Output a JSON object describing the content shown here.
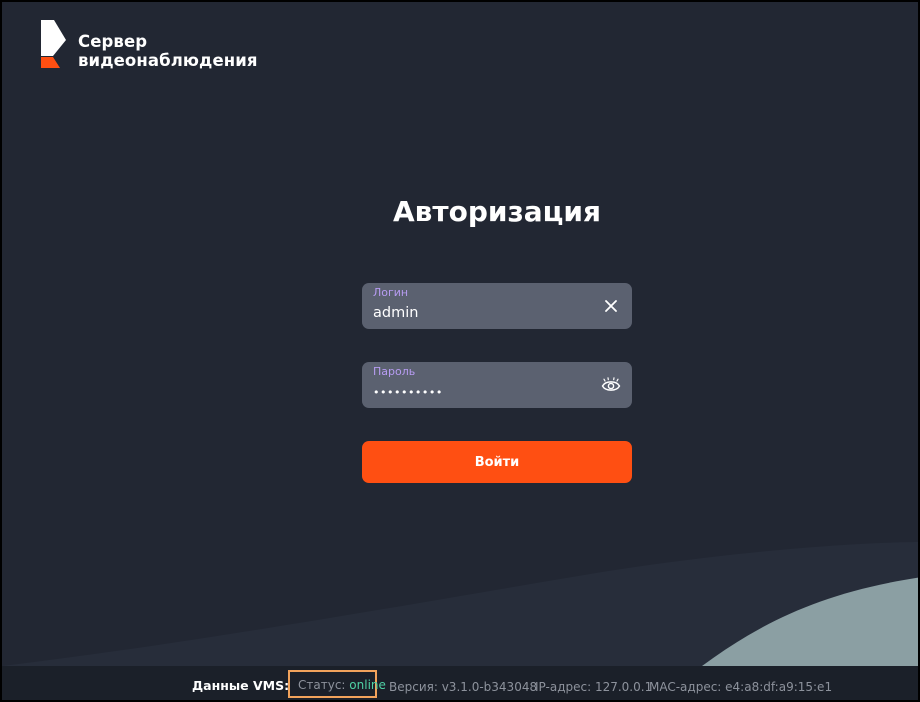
{
  "logo": {
    "line1": "Сервер",
    "line2": "видеонаблюдения",
    "colors": {
      "white": "#ffffff",
      "accent": "#ff4f12"
    }
  },
  "login_form": {
    "title": "Авторизация",
    "login_field": {
      "label": "Логин",
      "value": "admin",
      "action_icon": "clear-x-icon"
    },
    "password_field": {
      "label": "Пароль",
      "value": "••••••••••",
      "action_icon": "eye-icon"
    },
    "submit_label": "Войти"
  },
  "footer": {
    "label": "Данные VMS:",
    "status_label": "Статус: ",
    "status_value": "online",
    "version": "Версия: v3.1.0-b343048",
    "ip": "IP-адрес: 127.0.0.1",
    "mac": "MAC-адрес: e4:a8:df:a9:15:e1"
  },
  "colors": {
    "background": "#222733",
    "field": "#5b6170",
    "field_label": "#b79cf2",
    "button": "#ff4f12",
    "status_online": "#4fd1a5",
    "status_highlight": "#f1a25b"
  }
}
